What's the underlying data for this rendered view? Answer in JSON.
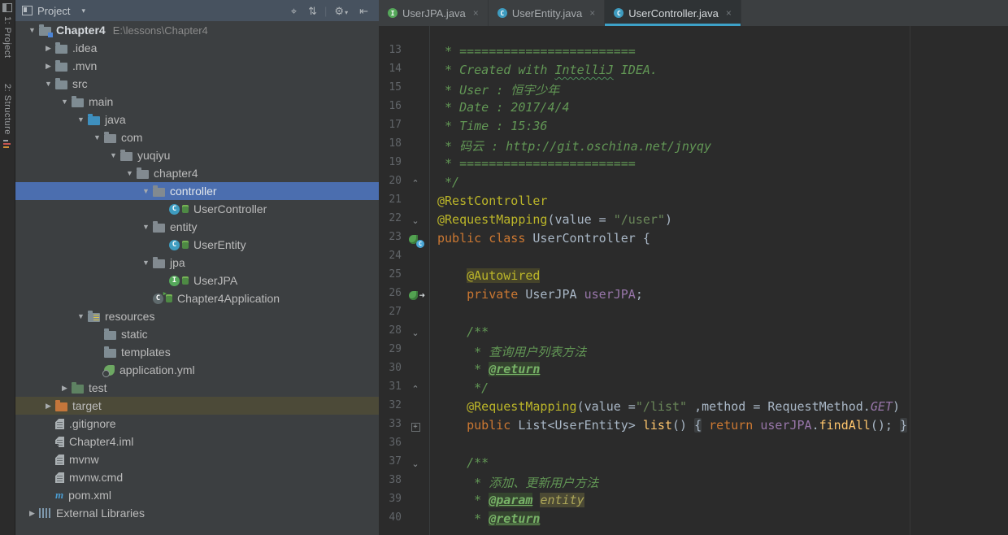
{
  "theme": {
    "panel_bg": "#3C3F41",
    "editor_bg": "#2B2B2B",
    "header_bg": "#47525F",
    "selection_blue": "#4B6EAF",
    "excluded_row_olive": "#4C4A38",
    "tab_underline": "#3DA1C8",
    "annotation_yellow": "#BBB529",
    "keyword_orange": "#CC7832",
    "string_green": "#6A8759",
    "comment_green": "#629755",
    "field_purple": "#9876AA"
  },
  "stripe": {
    "buttons": [
      {
        "label": "1: Project",
        "icon": "project-tool-icon"
      },
      {
        "label": "2: Structure",
        "icon": "structure-tool-icon"
      }
    ]
  },
  "project": {
    "header": {
      "title": "Project",
      "icons": [
        {
          "name": "locate-icon",
          "glyph": "⌖"
        },
        {
          "name": "collapse-all-icon",
          "glyph": "⇅"
        },
        {
          "name": "divider",
          "glyph": "|"
        },
        {
          "name": "settings-gear-icon",
          "glyph": "⚙",
          "sub": "▾"
        },
        {
          "name": "hide-panel-icon",
          "glyph": "⇤"
        }
      ]
    },
    "tree": [
      {
        "label": "Chapter4",
        "path": "E:\\lessons\\Chapter4",
        "level": 0,
        "arrow": "down",
        "icon": "project-root",
        "bold": true
      },
      {
        "label": ".idea",
        "level": 1,
        "arrow": "right",
        "icon": "folder"
      },
      {
        "label": ".mvn",
        "level": 1,
        "arrow": "right",
        "icon": "folder"
      },
      {
        "label": "src",
        "level": 1,
        "arrow": "down",
        "icon": "folder"
      },
      {
        "label": "main",
        "level": 2,
        "arrow": "down",
        "icon": "folder"
      },
      {
        "label": "java",
        "level": 3,
        "arrow": "down",
        "icon": "source-folder"
      },
      {
        "label": "com",
        "level": 4,
        "arrow": "down",
        "icon": "package"
      },
      {
        "label": "yuqiyu",
        "level": 5,
        "arrow": "down",
        "icon": "package"
      },
      {
        "label": "chapter4",
        "level": 6,
        "arrow": "down",
        "icon": "package"
      },
      {
        "label": "controller",
        "level": 7,
        "arrow": "down",
        "icon": "package",
        "sel": "blue"
      },
      {
        "label": "UserController",
        "level": 8,
        "arrow": null,
        "icon": "class"
      },
      {
        "label": "entity",
        "level": 7,
        "arrow": "down",
        "icon": "package"
      },
      {
        "label": "UserEntity",
        "level": 8,
        "arrow": null,
        "icon": "class"
      },
      {
        "label": "jpa",
        "level": 7,
        "arrow": "down",
        "icon": "package"
      },
      {
        "label": "UserJPA",
        "level": 8,
        "arrow": null,
        "icon": "interface"
      },
      {
        "label": "Chapter4Application",
        "level": 7,
        "arrow": null,
        "icon": "boot-class"
      },
      {
        "label": "resources",
        "level": 3,
        "arrow": "down",
        "icon": "resources-folder"
      },
      {
        "label": "static",
        "level": 4,
        "arrow": null,
        "icon": "folder"
      },
      {
        "label": "templates",
        "level": 4,
        "arrow": null,
        "icon": "folder"
      },
      {
        "label": "application.yml",
        "level": 4,
        "arrow": null,
        "icon": "spring-config"
      },
      {
        "label": "test",
        "level": 2,
        "arrow": "right",
        "icon": "test-folder"
      },
      {
        "label": "target",
        "level": 1,
        "arrow": "right",
        "icon": "excluded-folder",
        "sel": "olive"
      },
      {
        "label": ".gitignore",
        "level": 1,
        "arrow": null,
        "icon": "file"
      },
      {
        "label": "Chapter4.iml",
        "level": 1,
        "arrow": null,
        "icon": "iml-file"
      },
      {
        "label": "mvnw",
        "level": 1,
        "arrow": null,
        "icon": "file"
      },
      {
        "label": "mvnw.cmd",
        "level": 1,
        "arrow": null,
        "icon": "file"
      },
      {
        "label": "pom.xml",
        "level": 1,
        "arrow": null,
        "icon": "maven"
      },
      {
        "label": "External Libraries",
        "level": 0,
        "arrow": "right",
        "icon": "ext-lib"
      }
    ]
  },
  "tabs": [
    {
      "label": "UserJPA.java",
      "icon": "interface",
      "active": false
    },
    {
      "label": "UserEntity.java",
      "icon": "class",
      "active": false
    },
    {
      "label": "UserController.java",
      "icon": "class",
      "active": true
    }
  ],
  "editor": {
    "lines": [
      {
        "n": "13",
        "seg": [
          [
            "d",
            " * ========================"
          ]
        ]
      },
      {
        "n": "14",
        "seg": [
          [
            "d",
            " * Created with "
          ],
          [
            "dw",
            "IntelliJ"
          ],
          [
            "d",
            " IDEA."
          ]
        ]
      },
      {
        "n": "15",
        "seg": [
          [
            "d",
            " * User : 恒宇少年"
          ]
        ]
      },
      {
        "n": "16",
        "seg": [
          [
            "d",
            " * Date : 2017/4/4"
          ]
        ]
      },
      {
        "n": "17",
        "seg": [
          [
            "d",
            " * Time : 15:36"
          ]
        ]
      },
      {
        "n": "18",
        "seg": [
          [
            "d",
            " * 码云 : http://git.oschina.net/jnyqy"
          ]
        ]
      },
      {
        "n": "19",
        "seg": [
          [
            "d",
            " * ========================"
          ]
        ]
      },
      {
        "n": "20",
        "fold": "end",
        "seg": [
          [
            "d",
            " */"
          ]
        ]
      },
      {
        "n": "21",
        "seg": [
          [
            "a",
            "@RestController"
          ]
        ]
      },
      {
        "n": "22",
        "fold": "start",
        "seg": [
          [
            "a",
            "@RequestMapping"
          ],
          [
            "p",
            "(value = "
          ],
          [
            "s",
            "\"/user\""
          ],
          [
            "p",
            ")"
          ]
        ]
      },
      {
        "n": "23",
        "gicon": "bean-class",
        "seg": [
          [
            "k",
            "public class"
          ],
          [
            "p",
            " UserController {"
          ]
        ]
      },
      {
        "n": "24",
        "seg": []
      },
      {
        "n": "25",
        "seg": [
          [
            "p",
            "    "
          ],
          [
            "ah",
            "@Autowired"
          ]
        ]
      },
      {
        "n": "26",
        "gicon": "bean-autowired",
        "seg": [
          [
            "p",
            "    "
          ],
          [
            "k",
            "private"
          ],
          [
            "p",
            " UserJPA "
          ],
          [
            "f",
            "userJPA"
          ],
          [
            "p",
            ";"
          ]
        ]
      },
      {
        "n": "27",
        "seg": []
      },
      {
        "n": "28",
        "fold": "start",
        "seg": [
          [
            "d",
            "    /**"
          ]
        ]
      },
      {
        "n": "29",
        "seg": [
          [
            "d",
            "     * 查询用户列表方法"
          ]
        ]
      },
      {
        "n": "30",
        "seg": [
          [
            "d",
            "     * "
          ],
          [
            "dt",
            "@return"
          ]
        ]
      },
      {
        "n": "31",
        "fold": "end",
        "seg": [
          [
            "d",
            "     */"
          ]
        ]
      },
      {
        "n": "32",
        "seg": [
          [
            "p",
            "    "
          ],
          [
            "a",
            "@RequestMapping"
          ],
          [
            "p",
            "(value ="
          ],
          [
            "s",
            "\"/list\""
          ],
          [
            "p",
            " ,method = RequestMethod."
          ],
          [
            "st",
            "GET"
          ],
          [
            "p",
            ")"
          ]
        ]
      },
      {
        "n": "33",
        "fold": "plus",
        "seg": [
          [
            "p",
            "    "
          ],
          [
            "k",
            "public"
          ],
          [
            "p",
            " List<UserEntity> "
          ],
          [
            "m",
            "list"
          ],
          [
            "p",
            "() "
          ],
          [
            "fb",
            "{"
          ],
          [
            "p",
            " "
          ],
          [
            "k",
            "return"
          ],
          [
            "p",
            " "
          ],
          [
            "f",
            "userJPA"
          ],
          [
            "p",
            "."
          ],
          [
            "m",
            "findAll"
          ],
          [
            "p",
            "();"
          ],
          [
            "p",
            " "
          ],
          [
            "fb",
            "}"
          ]
        ]
      },
      {
        "n": "36",
        "seg": []
      },
      {
        "n": "37",
        "fold": "start",
        "seg": [
          [
            "d",
            "    /**"
          ]
        ]
      },
      {
        "n": "38",
        "seg": [
          [
            "d",
            "     * 添加、更新用户方法"
          ]
        ]
      },
      {
        "n": "39",
        "seg": [
          [
            "d",
            "     * "
          ],
          [
            "dt",
            "@param"
          ],
          [
            "d",
            " "
          ],
          [
            "dp",
            "entity"
          ]
        ]
      },
      {
        "n": "40",
        "seg": [
          [
            "d",
            "     * "
          ],
          [
            "dt",
            "@return"
          ]
        ]
      }
    ]
  }
}
